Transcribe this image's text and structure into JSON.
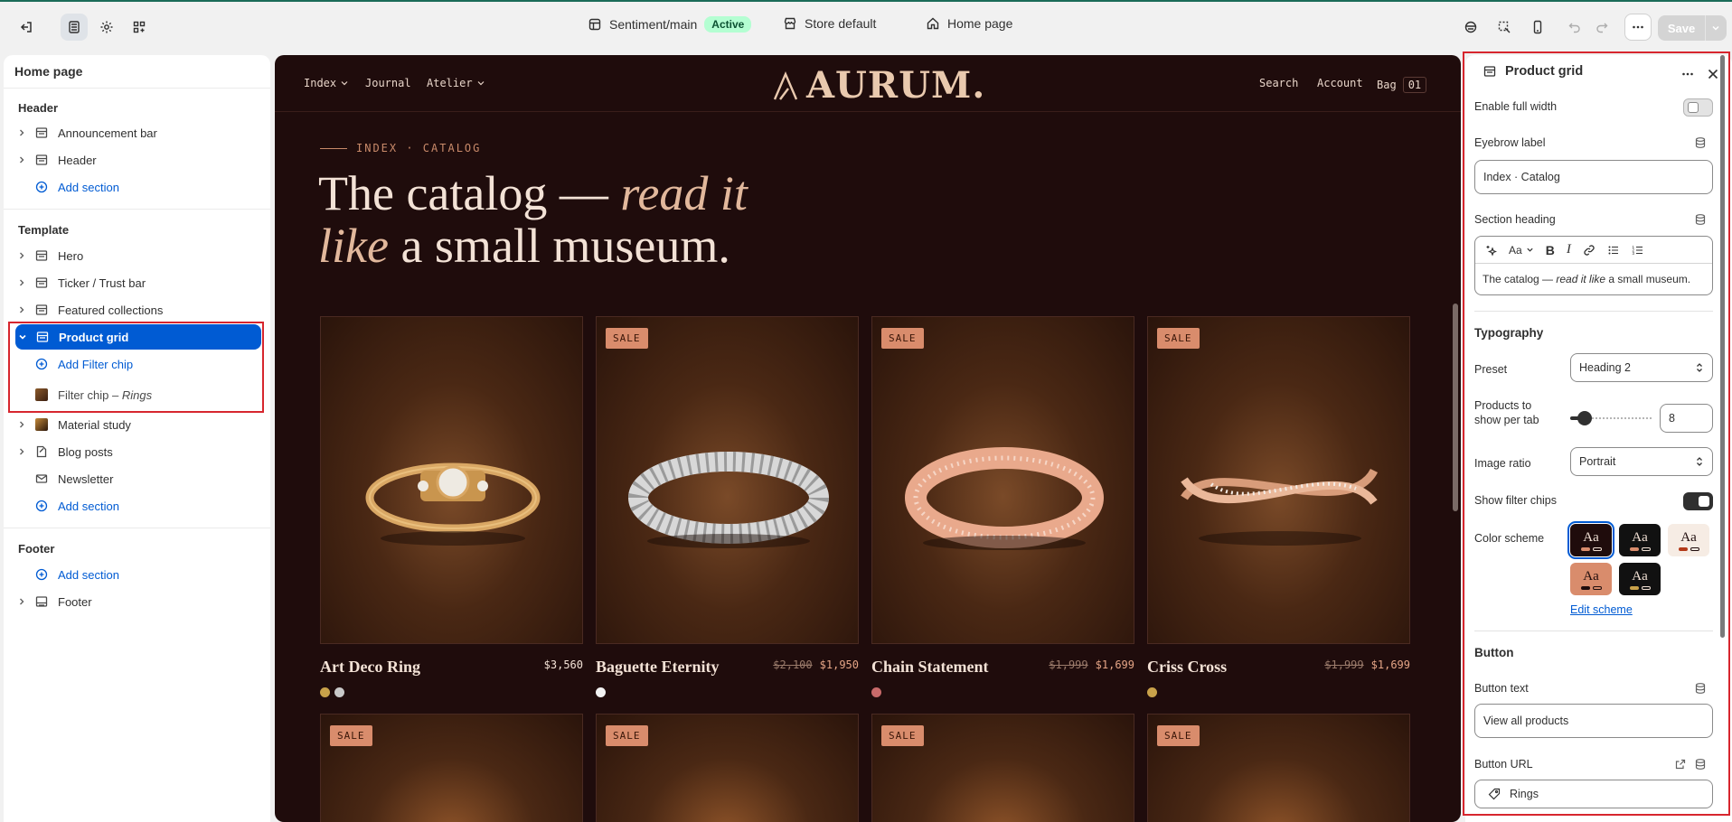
{
  "topbar": {
    "theme_name": "Sentiment/main",
    "theme_status": "Active",
    "store": "Store default",
    "page": "Home page",
    "save_label": "Save",
    "icons": [
      "exit-icon",
      "sections-icon",
      "settings-icon",
      "apps-icon",
      "theme-icon",
      "store-icon",
      "home-icon",
      "preview-icon",
      "inspector-icon",
      "mobile-icon",
      "undo-icon",
      "redo-icon",
      "more-icon"
    ]
  },
  "left": {
    "title": "Home page",
    "header_group": "Header",
    "header_items": [
      "Announcement bar",
      "Header"
    ],
    "add_section": "Add section",
    "template_group": "Template",
    "template_items_top": [
      "Hero",
      "Ticker / Trust bar",
      "Featured collections"
    ],
    "selected": "Product grid",
    "add_block": "Add Filter chip",
    "block_name": "Filter chip",
    "block_value": "Rings",
    "template_items_bottom": [
      "Material study",
      "Blog posts",
      "Newsletter"
    ],
    "footer_group": "Footer",
    "footer_items": [
      "Footer"
    ]
  },
  "preview": {
    "nav_left": [
      "Index",
      "Journal",
      "Atelier"
    ],
    "logo": "AURUM.",
    "nav_right": [
      "Search",
      "Account",
      "Bag"
    ],
    "bag_count": "01",
    "eyebrow": "INDEX · CATALOG",
    "heading_part1": "The catalog —",
    "heading_em1": "read it",
    "heading_em2": "like",
    "heading_part2": "a small museum.",
    "sale_label": "SALE",
    "products": [
      {
        "name": "Art Deco Ring",
        "price": "$3,560",
        "compare": "",
        "swatches": [
          "#c9a24a",
          "#c9c9c9"
        ]
      },
      {
        "name": "Baguette Eternity",
        "price": "$1,950",
        "compare": "$2,100",
        "swatches": [
          "#f2f2f2"
        ]
      },
      {
        "name": "Chain Statement",
        "price": "$1,699",
        "compare": "$1,999",
        "swatches": [
          "#c86a6a"
        ]
      },
      {
        "name": "Criss Cross",
        "price": "$1,699",
        "compare": "$1,999",
        "swatches": [
          "#c9a24a"
        ]
      }
    ]
  },
  "right": {
    "title": "Product grid",
    "enable_full_width": "Enable full width",
    "eyebrow_label": "Eyebrow label",
    "eyebrow_value": "Index · Catalog",
    "section_heading": "Section heading",
    "heading_value_a": "The catalog — ",
    "heading_value_em": "read it like",
    "heading_value_b": " a small museum.",
    "typography": "Typography",
    "preset_label": "Preset",
    "preset_value": "Heading 2",
    "products_label": "Products to show per tab",
    "products_value": "8",
    "products_fraction": 0.1,
    "image_ratio_label": "Image ratio",
    "image_ratio_value": "Portrait",
    "show_filter_chips": "Show filter chips",
    "color_scheme": "Color scheme",
    "scheme_sample": "Aa",
    "edit_scheme": "Edit scheme",
    "button_h": "Button",
    "button_text_label": "Button text",
    "button_text_value": "View all products",
    "button_url_label": "Button URL",
    "button_url_value": "Rings"
  },
  "colors": {
    "selected": "#005bd3",
    "highlight": "#d7262e",
    "preview_bg": "#1f0c0c",
    "sale_badge": "#d98c6c"
  }
}
